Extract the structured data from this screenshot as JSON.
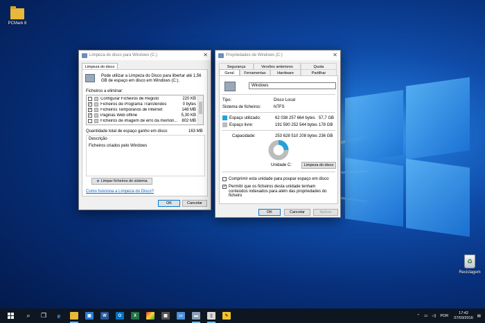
{
  "desktop": {
    "icons": [
      {
        "label": "PCMark 8",
        "icon": "folder-icon"
      },
      {
        "label": "Reciclagem",
        "icon": "recycle-bin-icon"
      }
    ]
  },
  "cleanup": {
    "title": "Limpeza do disco para Windows (C:)",
    "tab": "Limpeza do disco",
    "intro": "Pode utilizar a Limpeza do Disco para libertar até 1,56 GB de espaço em disco em Windows (C:).",
    "files_label": "Ficheiros a eliminar:",
    "files": [
      {
        "name": "Configurar Ficheiros de Registo",
        "size": "220 KB",
        "checked": false
      },
      {
        "name": "Ficheiros de Programa Transferidos",
        "size": "0 bytes",
        "checked": true
      },
      {
        "name": "Ficheiros Temporários de Internet",
        "size": "148 MB",
        "checked": true
      },
      {
        "name": "Páginas Web offline",
        "size": "5,30 KB",
        "checked": true
      },
      {
        "name": "Ficheiros de imagem de erro da memóri...",
        "size": "802 MB",
        "checked": false
      }
    ],
    "total_label": "Quantidade total de espaço ganho em disco",
    "total_value": "163 MB",
    "desc_label": "Descrição",
    "desc_text": "Ficheiros criados pelo Windows",
    "sys_button": "Limpar ficheiros do sistema",
    "help_link": "Como funciona a Limpeza do Disco?",
    "ok": "OK",
    "cancel": "Cancelar"
  },
  "props": {
    "title": "Propriedades de Windows (C:)",
    "tabs_top": [
      "Segurança",
      "Versões anteriores",
      "Quota"
    ],
    "tabs_bottom": [
      "Geral",
      "Ferramentas",
      "Hardware",
      "Partilhar"
    ],
    "name": "Windows",
    "type_label": "Tipo:",
    "type_value": "Disco Local",
    "fs_label": "Sistema de ficheiros:",
    "fs_value": "NTFS",
    "used_label": "Espaço utilizado:",
    "used_bytes": "62 038 257 664 bytes",
    "used_gb": "57,7 GB",
    "free_label": "Espaço livre:",
    "free_bytes": "191 590 252 544 bytes",
    "free_gb": "178 GB",
    "cap_label": "Capacidade:",
    "cap_bytes": "253 628 510 208 bytes",
    "cap_gb": "236 GB",
    "used_fraction": 0.245,
    "drive_label": "Unidade C:",
    "cleanup_button": "Limpeza do disco",
    "compress_label": "Comprimir esta unidade para poupar espaço em disco",
    "index_label": "Permitir que os ficheiros desta unidade tenham conteúdos indexados para além das propriedades do ficheiro",
    "ok": "OK",
    "cancel": "Cancelar",
    "apply": "Aplicar",
    "colors": {
      "used": "#26a0da",
      "free": "#bcbcbc"
    }
  },
  "tray": {
    "lang": "POR",
    "time": "17:42",
    "date": "07/03/2016"
  }
}
